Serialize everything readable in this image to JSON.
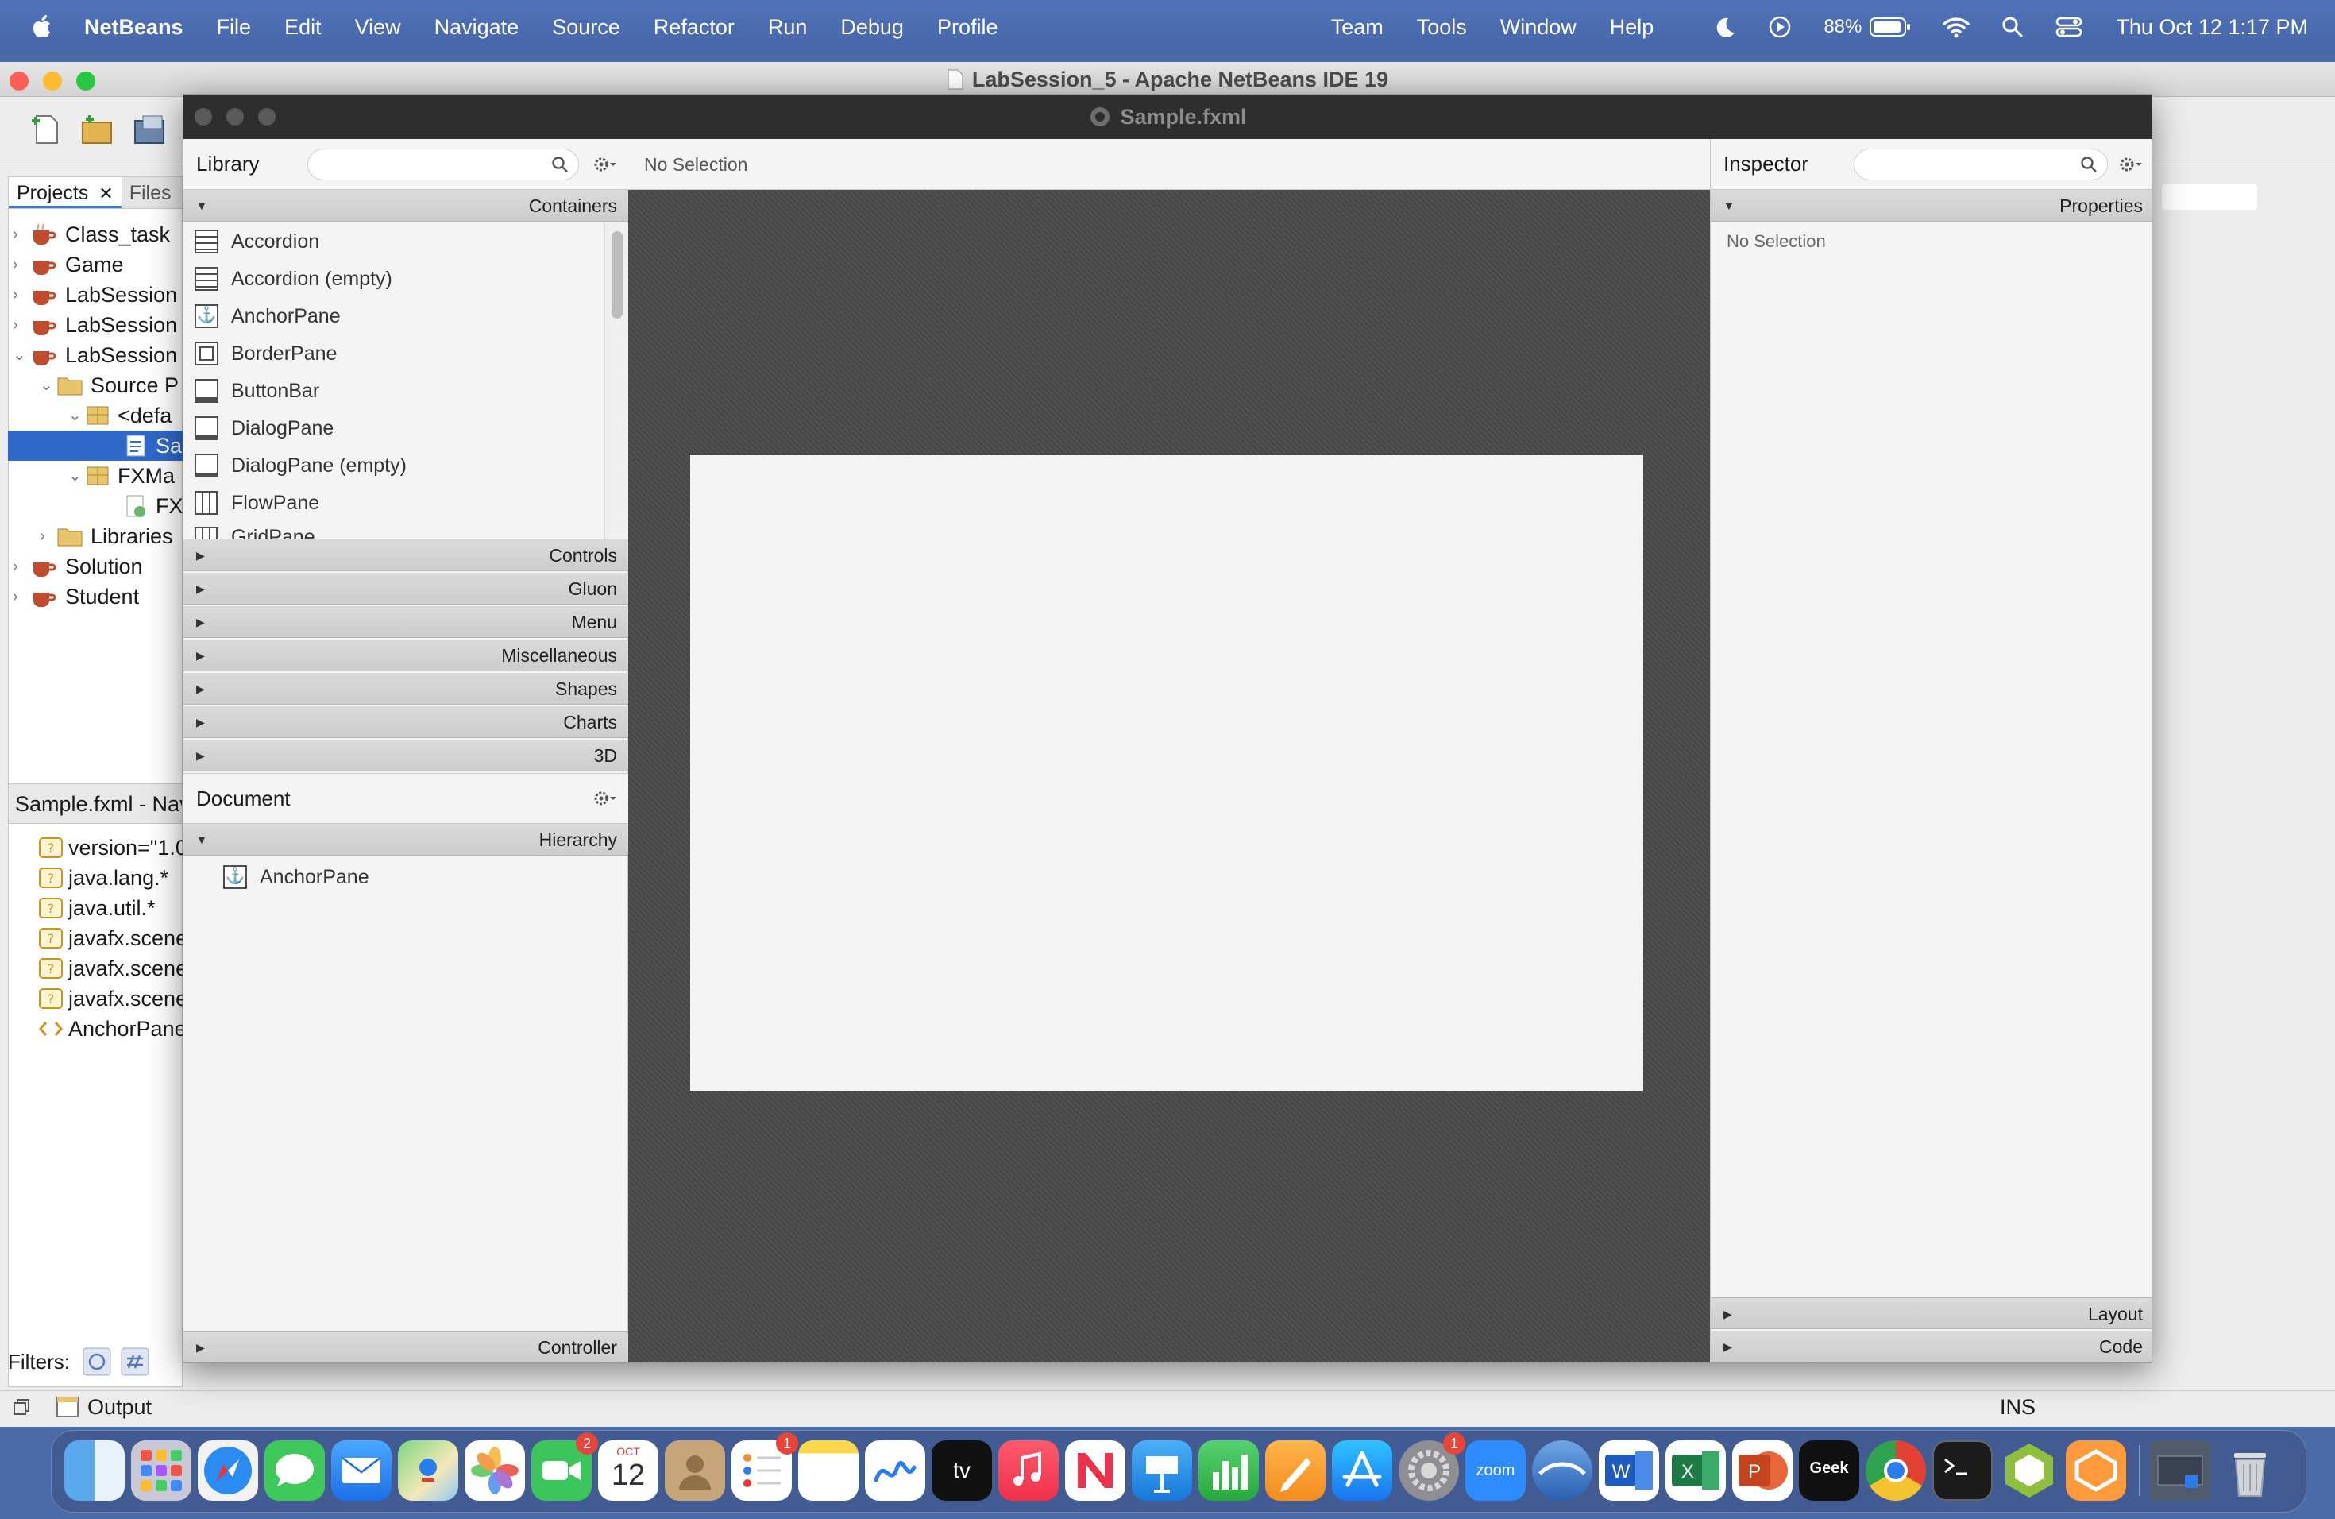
{
  "menubar": {
    "app_name": "NetBeans",
    "items": [
      "File",
      "Edit",
      "View",
      "Navigate",
      "Source",
      "Refactor",
      "Run",
      "Debug",
      "Profile"
    ],
    "right_items": [
      "Team",
      "Tools",
      "Window",
      "Help"
    ],
    "battery": "88%",
    "datetime": "Thu Oct 12  1:17 PM"
  },
  "netbeans": {
    "window_title": "LabSession_5 - Apache NetBeans IDE 19",
    "projects_tab": "Projects",
    "files_tab": "Files",
    "tree": {
      "class_task": "Class_task",
      "game": "Game",
      "lab1": "LabSession",
      "lab2": "LabSession",
      "lab3": "LabSession",
      "source": "Source P",
      "default_pkg": "<defa",
      "sample": "Sa",
      "fxmain": "FXMa",
      "fx": "FX",
      "libraries": "Libraries",
      "solution": "Solution",
      "student": "Student"
    },
    "navigator_title": "Sample.fxml - Navi",
    "navigator_items": [
      "version=\"1.0",
      "java.lang.*",
      "java.util.*",
      "javafx.scene",
      "javafx.scene",
      "javafx.scene",
      "AnchorPane"
    ],
    "filters_label": "Filters:",
    "output_label": "Output",
    "ins_label": "INS"
  },
  "scenebuilder": {
    "window_title": "Sample.fxml",
    "library_label": "Library",
    "containers_label": "Containers",
    "containers": [
      "Accordion",
      "Accordion  (empty)",
      "AnchorPane",
      "BorderPane",
      "ButtonBar",
      "DialogPane",
      "DialogPane  (empty)",
      "FlowPane",
      "GridPane"
    ],
    "sections": [
      "Controls",
      "Gluon",
      "Menu",
      "Miscellaneous",
      "Shapes",
      "Charts",
      "3D"
    ],
    "document_label": "Document",
    "hierarchy_label": "Hierarchy",
    "hierarchy_item": "AnchorPane",
    "controller_label": "Controller",
    "canvas_status": "No Selection",
    "inspector_label": "Inspector",
    "properties_label": "Properties",
    "inspector_status": "No Selection",
    "layout_label": "Layout",
    "code_label": "Code"
  },
  "dock": {
    "calendar_month": "OCT",
    "calendar_day": "12",
    "facetime_badge": "2",
    "reminders_badge": "1",
    "settings_badge": "1",
    "appletv_label": "tv",
    "zoom_label": "zoom",
    "geek_label": "Geek"
  },
  "colors": {
    "desktop": "#4a6aa8",
    "selection": "#2f68c9",
    "sb_titlebar": "#2e2e2e"
  }
}
